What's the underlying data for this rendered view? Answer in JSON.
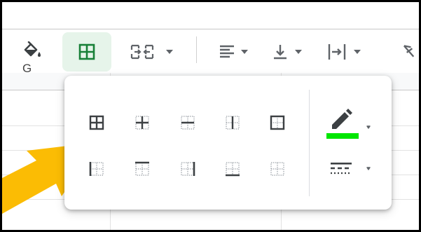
{
  "toolbar": {
    "items": [
      {
        "name": "fill-color",
        "icon": "paint-bucket-icon"
      },
      {
        "name": "borders",
        "icon": "borders-icon",
        "active": true
      },
      {
        "name": "merge-cells",
        "icon": "merge-cells-icon"
      },
      {
        "name": "horizontal-align",
        "icon": "align-left-icon"
      },
      {
        "name": "vertical-align",
        "icon": "align-bottom-icon"
      },
      {
        "name": "text-wrapping",
        "icon": "text-wrap-icon"
      },
      {
        "name": "text-rotation",
        "icon": "text-rotation-icon"
      }
    ],
    "accent_active_bg": "#e6f4ea",
    "accent_active_fg": "#188038"
  },
  "grid": {
    "visible_column_letter": "G"
  },
  "borders_menu": {
    "row1": [
      "all-borders",
      "inner-borders",
      "horizontal-borders",
      "vertical-borders",
      "outer-borders"
    ],
    "row2": [
      "left-border",
      "top-border",
      "right-border",
      "bottom-border",
      "clear-borders"
    ],
    "border_color": "#00e600",
    "border_color_label": "border-color",
    "border_style_label": "border-style"
  },
  "annotation": {
    "arrow_color": "#fbbc04"
  }
}
